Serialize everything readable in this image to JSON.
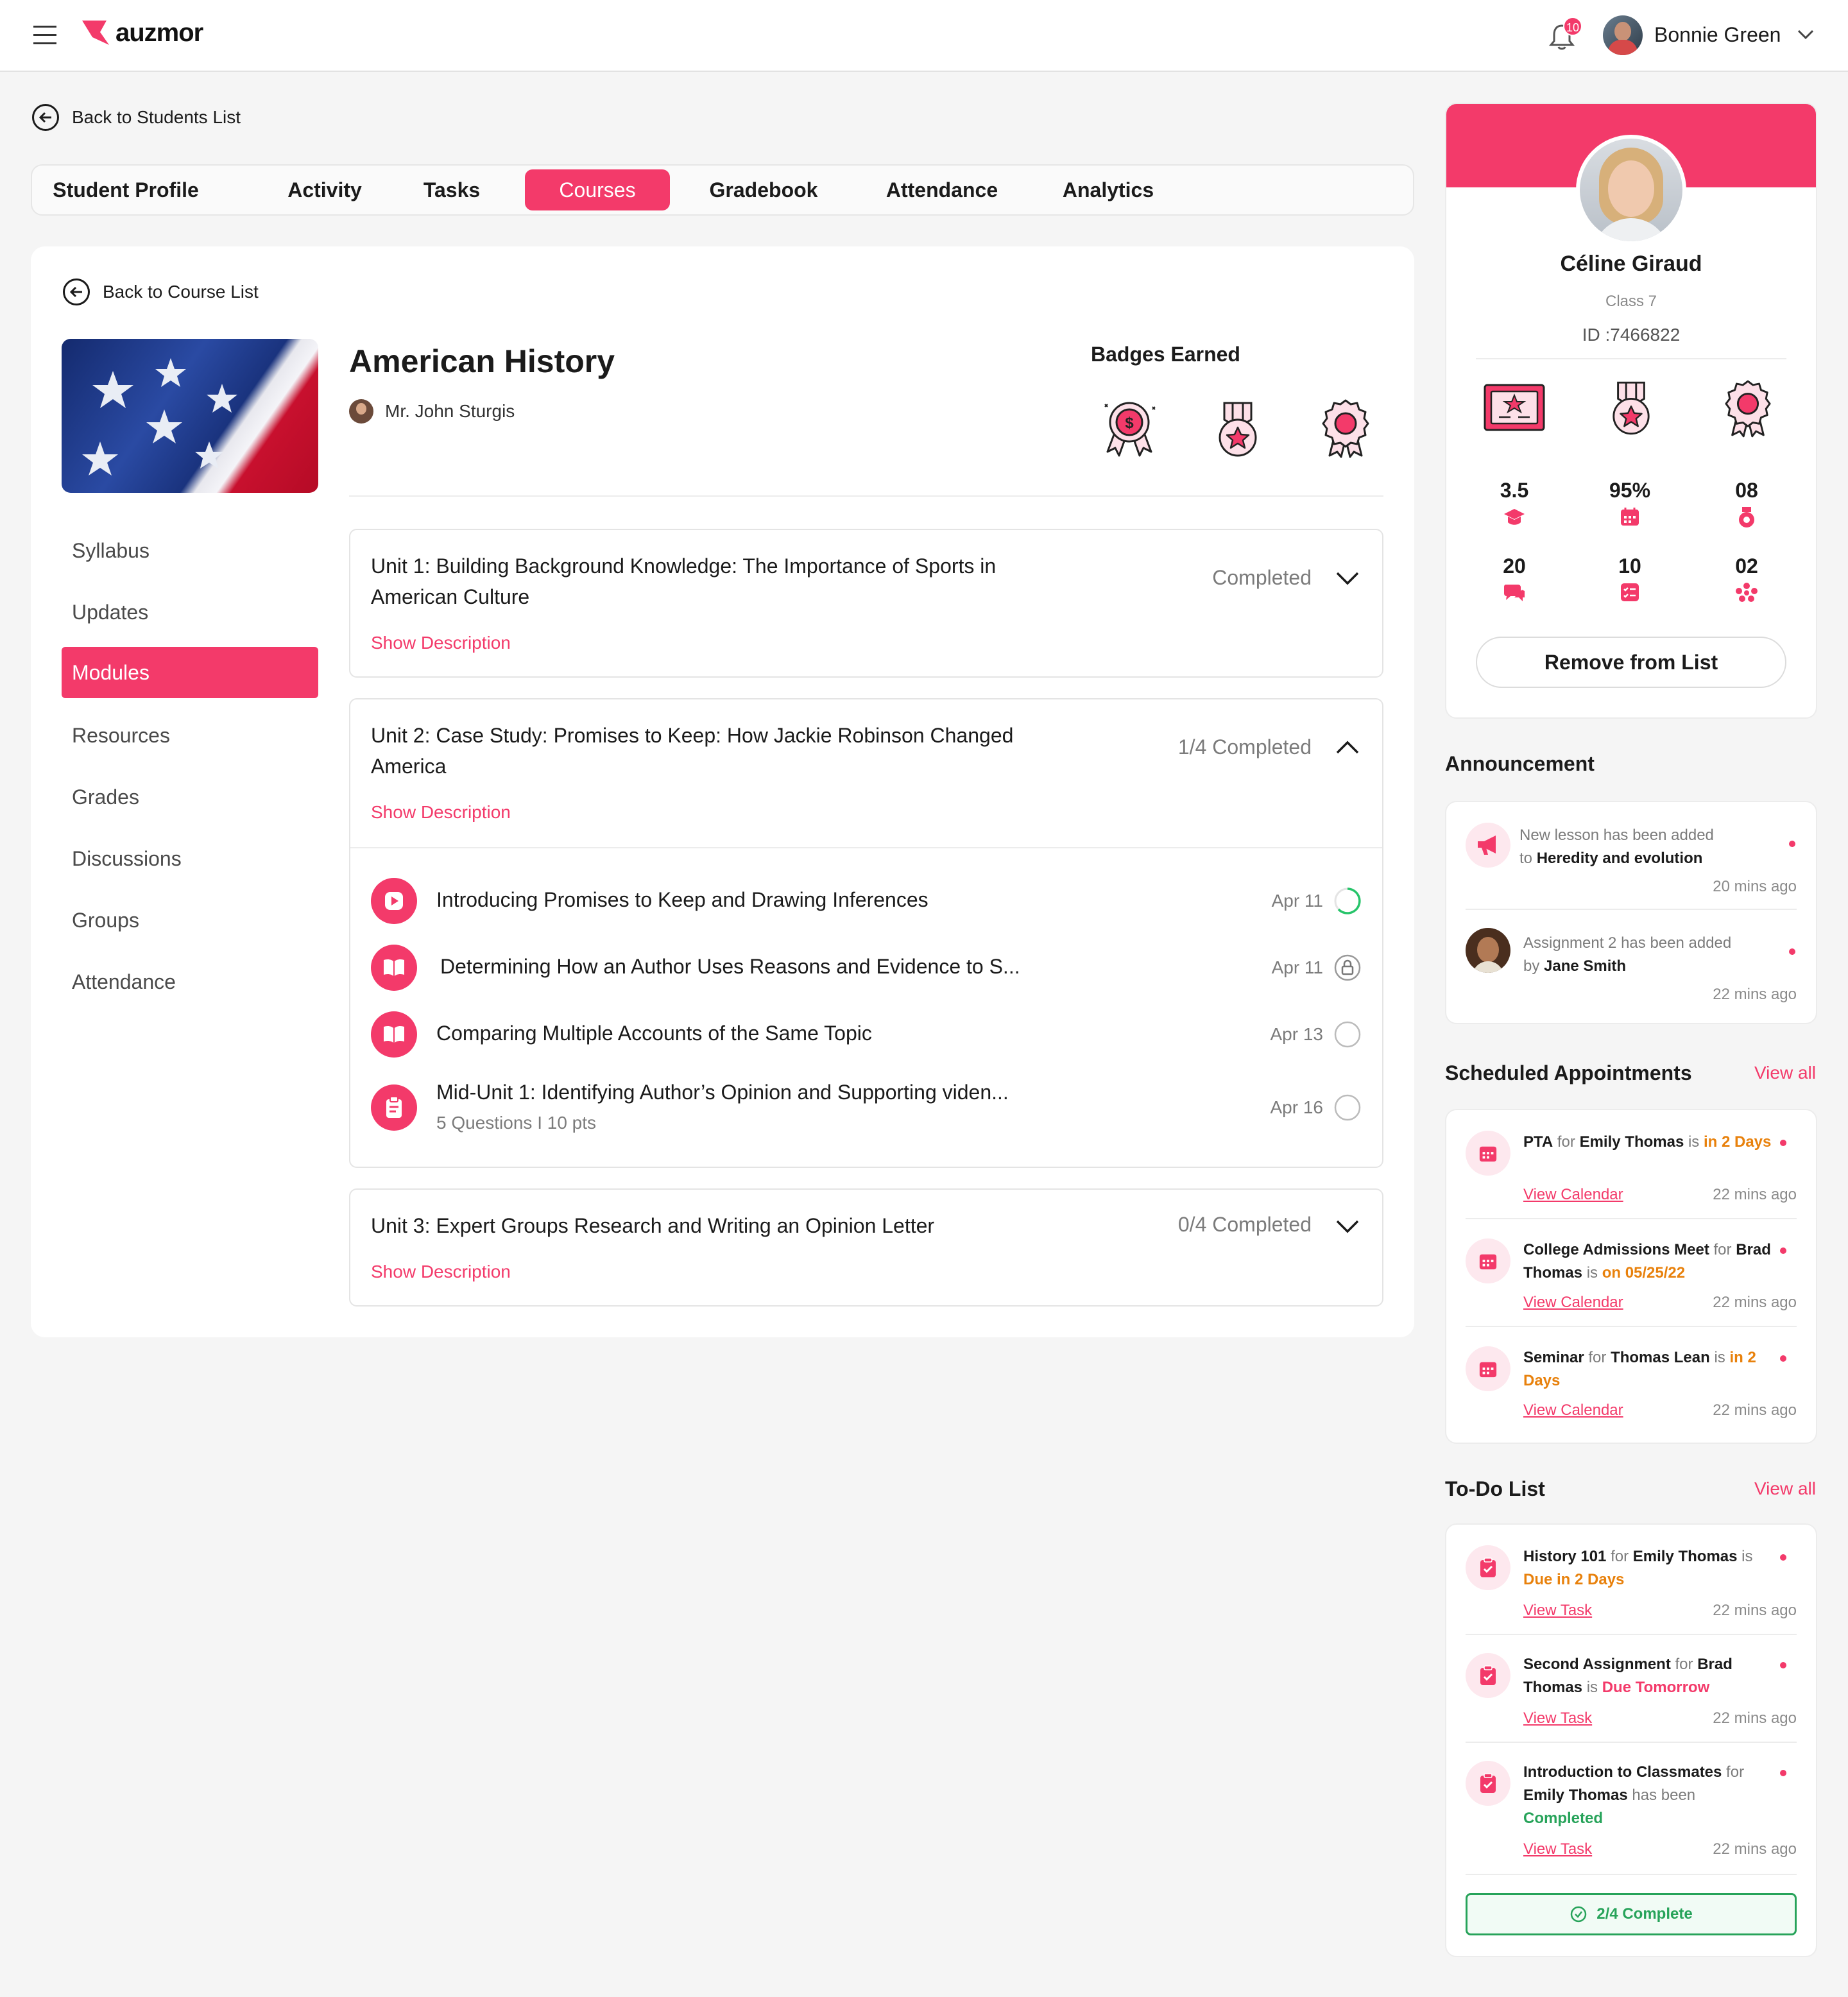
{
  "header": {
    "brand": "auzmor",
    "notification_count": "10",
    "user_name": "Bonnie Green"
  },
  "nav": {
    "back_students": "Back to Students List",
    "tabs": [
      "Student Profile",
      "Activity",
      "Tasks",
      "Courses",
      "Gradebook",
      "Attendance",
      "Analytics"
    ],
    "active_tab": "Courses"
  },
  "course": {
    "back_course": "Back to Course List",
    "title": "American History",
    "teacher": "Mr. John Sturgis",
    "badges_label": "Badges Earned",
    "sidebar": [
      "Syllabus",
      "Updates",
      "Modules",
      "Resources",
      "Grades",
      "Discussions",
      "Groups",
      "Attendance"
    ],
    "active_sidebar": "Modules",
    "show_description": "Show Description",
    "units": [
      {
        "title": "Unit 1: Building Background Knowledge: The Importance of Sports in American Culture",
        "status": "Completed"
      },
      {
        "title": "Unit 2: Case Study: Promises to Keep: How Jackie Robinson Changed America",
        "status": "1/4 Completed"
      },
      {
        "title": "Unit 3: Expert Groups Research and Writing an Opinion Letter",
        "status": "0/4 Completed"
      }
    ],
    "lessons": [
      {
        "title": "Introducing Promises to Keep and Drawing Inferences",
        "date": "Apr 11",
        "icon": "play-icon",
        "state": "in-progress"
      },
      {
        "title": "Determining How an Author Uses Reasons and Evidence to S...",
        "date": "Apr 11",
        "icon": "book-icon",
        "state": "locked"
      },
      {
        "title": "Comparing Multiple Accounts of the Same Topic",
        "date": "Apr 13",
        "icon": "book-icon",
        "state": "not-started"
      },
      {
        "title": "Mid-Unit 1: Identifying Author’s Opinion and Supporting viden...",
        "sub": "5 Questions I 10 pts",
        "date": "Apr 16",
        "icon": "clipboard-icon",
        "state": "not-started"
      }
    ]
  },
  "profile": {
    "name": "Céline Giraud",
    "class": "Class 7",
    "id": "ID :7466822",
    "stats": [
      {
        "value": "3.5",
        "icon": "graduation-cap-icon"
      },
      {
        "value": "95%",
        "icon": "calendar-icon"
      },
      {
        "value": "08",
        "icon": "badge-icon"
      },
      {
        "value": "20",
        "icon": "chat-icon"
      },
      {
        "value": "10",
        "icon": "checklist-icon"
      },
      {
        "value": "02",
        "icon": "group-icon"
      }
    ],
    "remove_button": "Remove from List"
  },
  "announcement": {
    "title": "Announcement",
    "items": [
      {
        "pre": "New lesson has been added",
        "mid": "to ",
        "bold": "Heredity and evolution",
        "time": "20 mins ago"
      },
      {
        "pre": "Assignment 2 has been added",
        "mid": "by ",
        "bold": "Jane Smith",
        "time": "22 mins ago"
      }
    ]
  },
  "appointments": {
    "title": "Scheduled Appointments",
    "view_all": "View all",
    "link": "View Calendar",
    "items": [
      {
        "event": "PTA",
        "for_word": "for",
        "person": "Emily Thomas",
        "is_word": "is",
        "when": "in 2 Days",
        "time": "22 mins ago"
      },
      {
        "event": "College Admissions Meet",
        "for_word": "for",
        "person": "Brad Thomas",
        "is_word": "is",
        "when": "on 05/25/22",
        "time": "22 mins ago"
      },
      {
        "event": "Seminar",
        "for_word": "for",
        "person": "Thomas Lean",
        "is_word": "is",
        "when": "in 2 Days",
        "time": "22 mins ago"
      }
    ]
  },
  "todo": {
    "title": "To-Do List",
    "view_all": "View all",
    "link": "View Task",
    "items": [
      {
        "task": "History 101",
        "for_word": "for",
        "person": "Emily Thomas",
        "is_word": "is",
        "status": "Due in 2 Days",
        "time": "22 mins ago"
      },
      {
        "task": "Second Assignment",
        "for_word": "for",
        "person": "Brad Thomas",
        "is_word": "is",
        "status": "Due Tomorrow",
        "time": "22 mins ago"
      },
      {
        "task": "Introduction to Classmates",
        "for_word": "for",
        "person": "Emily Thomas",
        "is_word": "has been",
        "status": "Completed",
        "time": "22 mins ago"
      }
    ],
    "complete_label": "2/4 Complete"
  },
  "colors": {
    "accent": "#f33a6a",
    "orange": "#e8810c",
    "green": "#27a35a"
  }
}
